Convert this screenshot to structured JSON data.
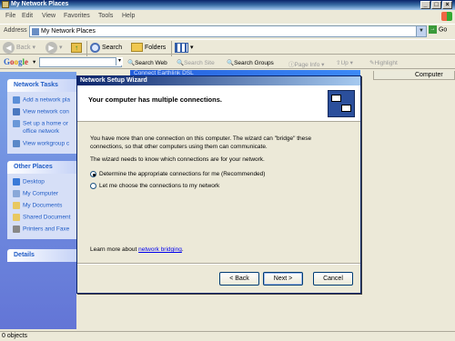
{
  "window": {
    "title": "My Network Places"
  },
  "menu": [
    "File",
    "Edit",
    "View",
    "Favorites",
    "Tools",
    "Help"
  ],
  "toolbar": {
    "back": "Back",
    "search": "Search",
    "folders": "Folders"
  },
  "address": {
    "label": "Address",
    "value": "My Network Places",
    "go": "Go"
  },
  "google": {
    "logo": "Google",
    "search_web": "Search Web",
    "search_site": "Search Site",
    "search_groups": "Search Groups",
    "page_info": "Page Info",
    "up": "Up",
    "highlight": "Highlight"
  },
  "column_header": "Computer",
  "background_window": "Connect Earthlink DSL",
  "network_tasks": {
    "title": "Network Tasks",
    "items": [
      "Add a network pla",
      "View network con",
      "Set up a home or",
      "office network",
      "View workgroup c"
    ]
  },
  "other_places": {
    "title": "Other Places",
    "items": [
      "Desktop",
      "My Computer",
      "My Documents",
      "Shared Document",
      "Printers and Faxe"
    ]
  },
  "details": {
    "title": "Details"
  },
  "wizard": {
    "title": "Network Setup Wizard",
    "header": "Your computer has multiple connections.",
    "para1_line1": "You have more than one connection on this computer. The wizard can \"bridge\" these",
    "para1_line2": "connections, so that other computers using them can communicate.",
    "para2": "The wizard needs to know which connections are for your network.",
    "option1": "Determine the appropriate connections for me (Recommended)",
    "option2": "Let me choose the connections to my network",
    "selected_option": 1,
    "learn_prefix": "Learn more about ",
    "learn_link": "network bridging",
    "learn_suffix": ".",
    "back": "< Back",
    "next": "Next >",
    "cancel": "Cancel"
  },
  "status": {
    "text": "0 objects"
  }
}
